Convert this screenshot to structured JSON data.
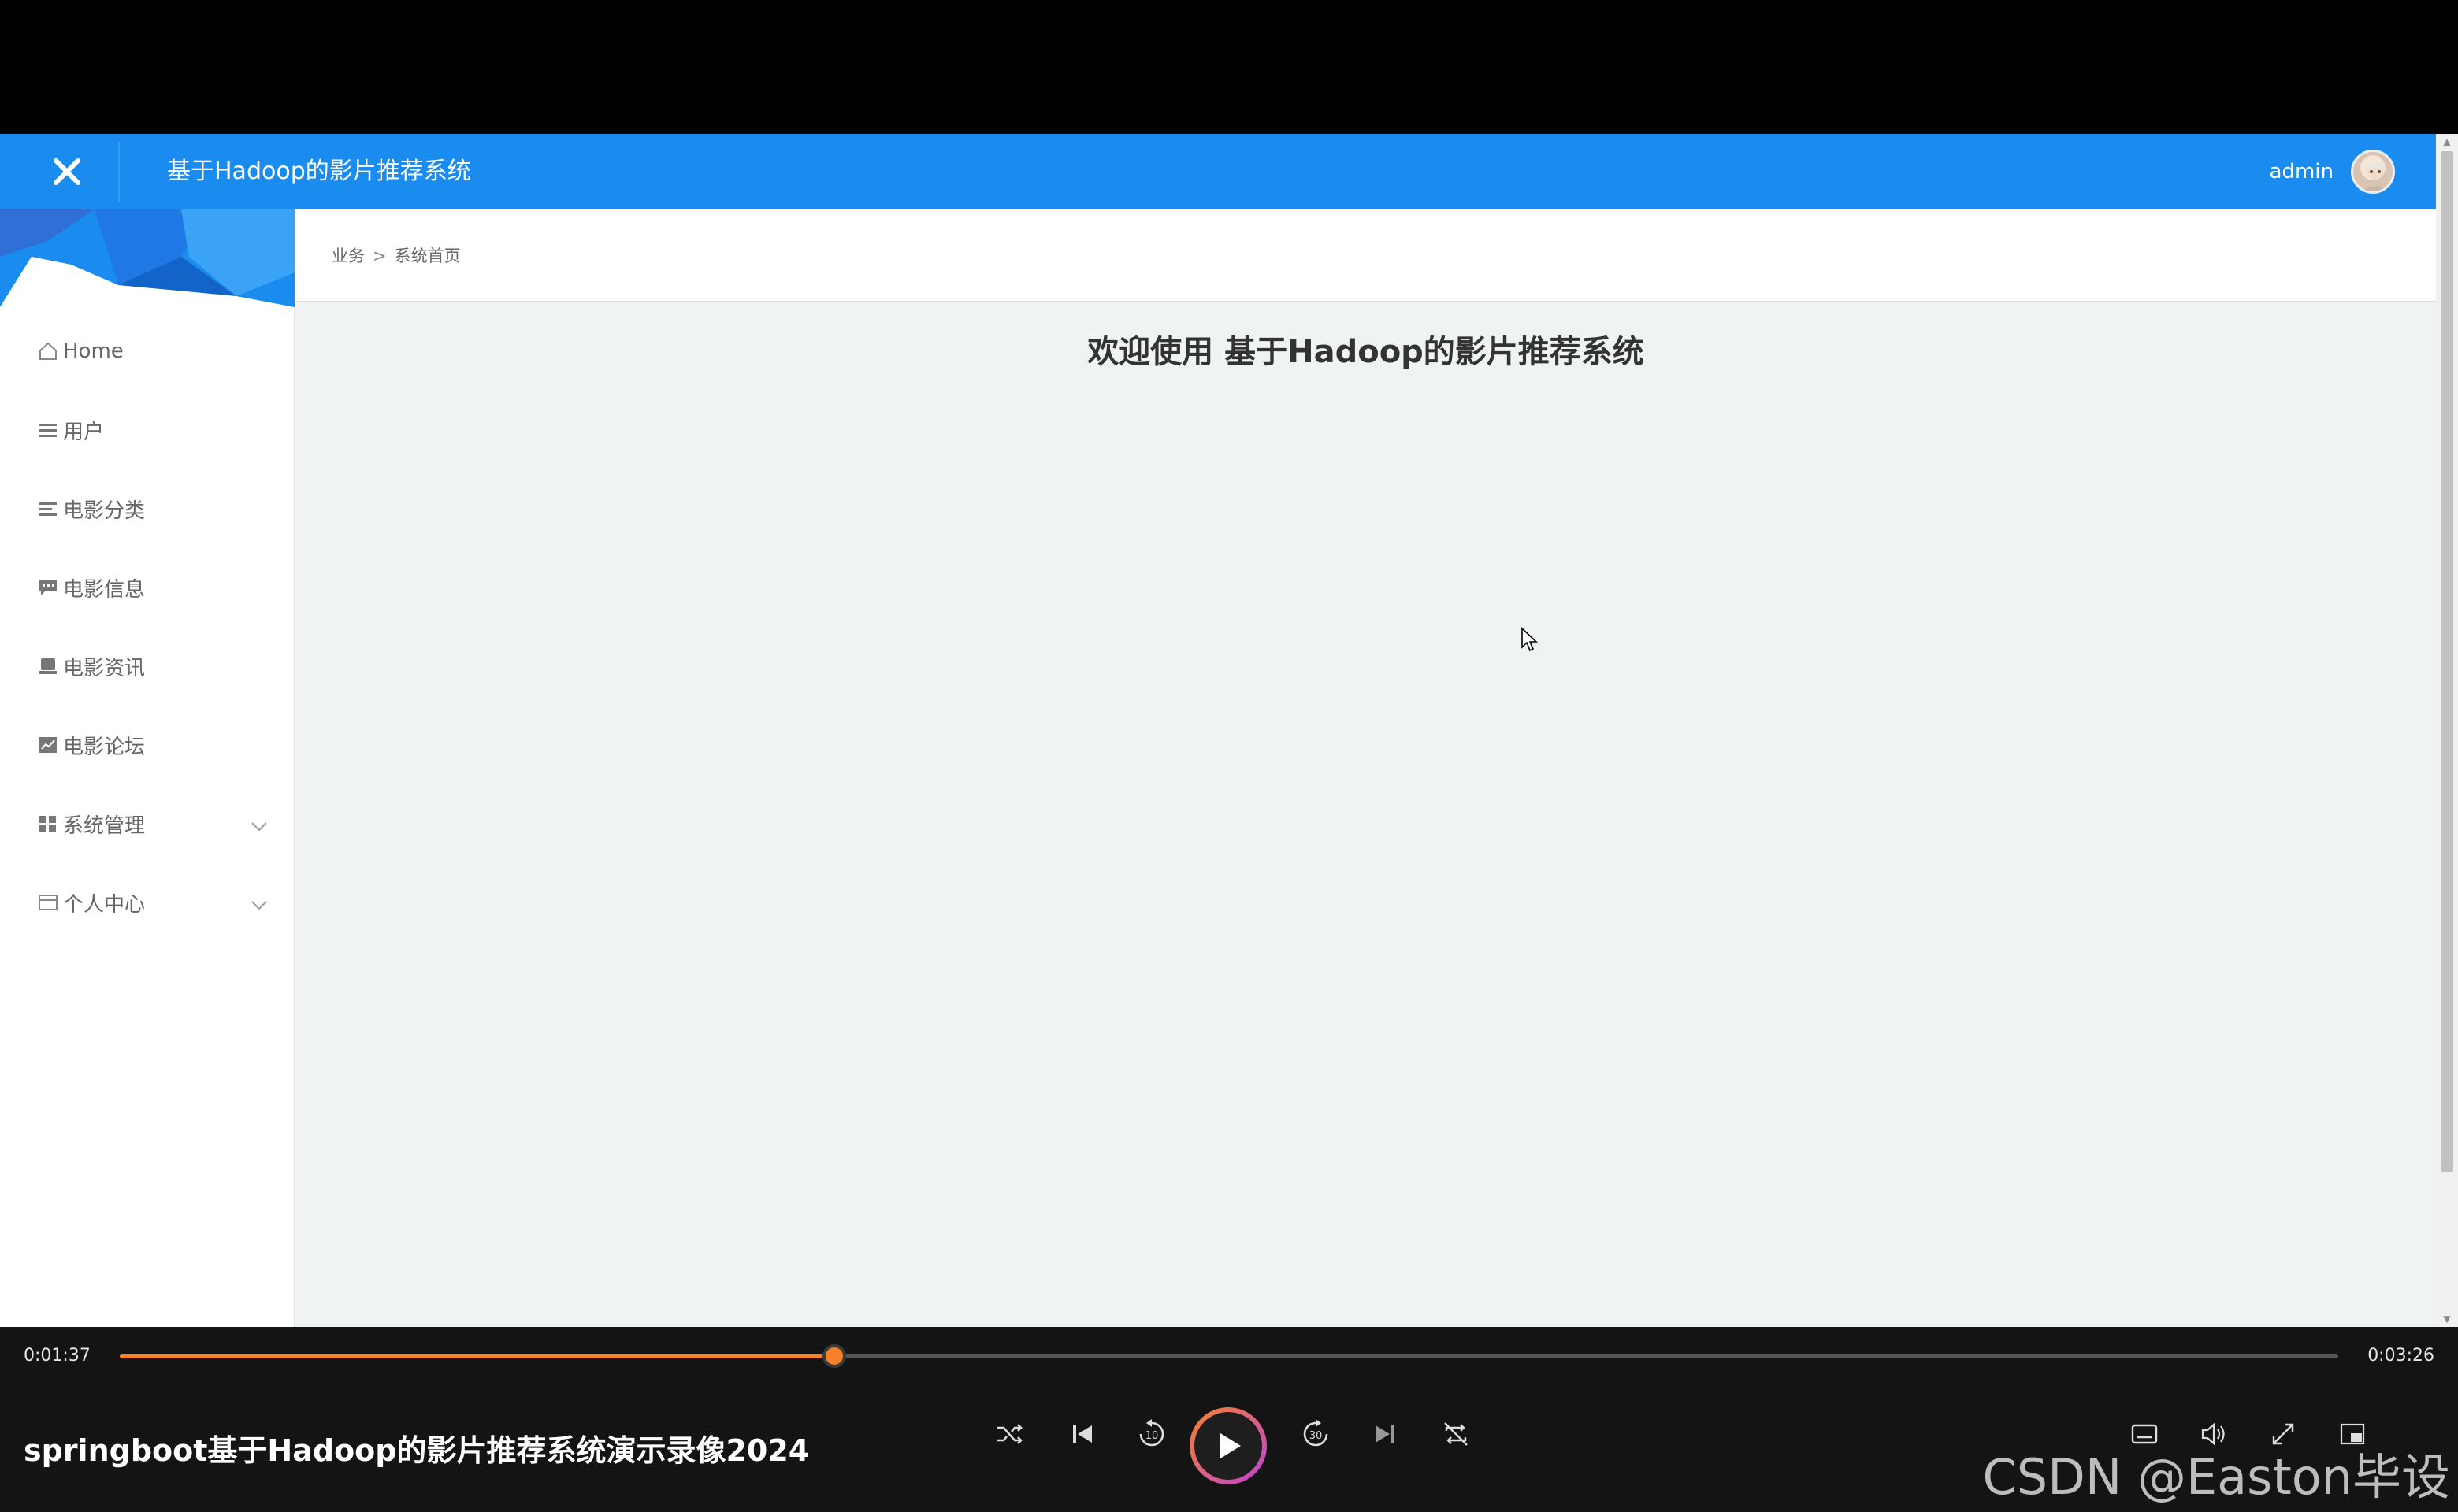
{
  "app": {
    "title": "基于Hadoop的影片推荐系统",
    "accent_color": "#1a8cf0",
    "admin_name": "admin"
  },
  "sidebar": {
    "items": [
      {
        "label": "Home",
        "icon": "home-icon"
      },
      {
        "label": "用户",
        "icon": "list-icon"
      },
      {
        "label": "电影分类",
        "icon": "list-icon"
      },
      {
        "label": "电影信息",
        "icon": "comment-icon"
      },
      {
        "label": "电影资讯",
        "icon": "tablet-icon"
      },
      {
        "label": "电影论坛",
        "icon": "chart-icon"
      },
      {
        "label": "系统管理",
        "icon": "grid-icon",
        "expandable": true
      },
      {
        "label": "个人中心",
        "icon": "card-icon",
        "expandable": true
      }
    ]
  },
  "breadcrumb": {
    "parent": "业务",
    "separator": ">",
    "current": "系统首页"
  },
  "main": {
    "welcome": "欢迎使用 基于Hadoop的影片推荐系统"
  },
  "player": {
    "current_time": "0:01:37",
    "total_time": "0:03:26",
    "progress_fraction": 0.322,
    "accent_color": "#f5822a",
    "video_title": "springboot基于Hadoop的影片推荐系统演示录像2024",
    "watermark": "CSDN @Easton毕设"
  }
}
